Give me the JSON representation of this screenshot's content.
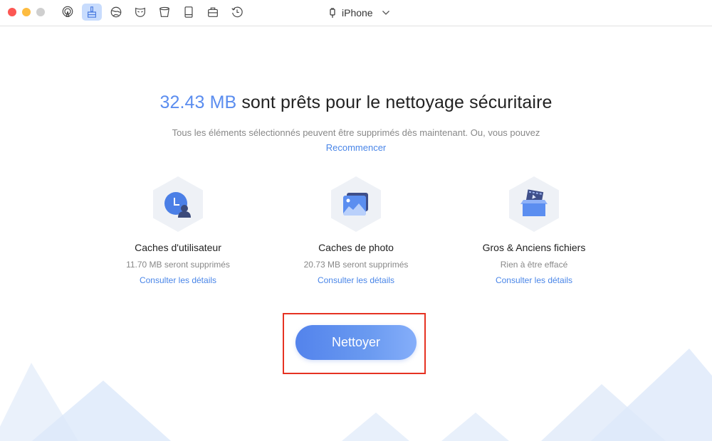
{
  "window": {
    "controls": [
      "close",
      "minimize",
      "maximize"
    ]
  },
  "toolbar": {
    "tools": [
      {
        "name": "airbackup-icon",
        "active": false
      },
      {
        "name": "cleaner-broom-icon",
        "active": true
      },
      {
        "name": "internet-globe-icon",
        "active": false
      },
      {
        "name": "privacy-mask-icon",
        "active": false
      },
      {
        "name": "trash-bin-icon",
        "active": false
      },
      {
        "name": "device-tablet-icon",
        "active": false
      },
      {
        "name": "toolkit-briefcase-icon",
        "active": false
      },
      {
        "name": "history-clock-icon",
        "active": false
      }
    ],
    "device_name": "iPhone"
  },
  "main": {
    "headline_size": "32.43 MB",
    "headline_rest": " sont prêts pour le nettoyage sécuritaire",
    "subtitle": "Tous les éléments sélectionnés peuvent être supprimés dès maintenant. Ou, vous pouvez",
    "restart_link": "Recommencer",
    "categories": [
      {
        "title": "Caches d'utilisateur",
        "status": "11.70 MB seront supprimés",
        "link": "Consulter les détails"
      },
      {
        "title": "Caches de photo",
        "status": "20.73 MB seront supprimés",
        "link": "Consulter les détails"
      },
      {
        "title": "Gros & Anciens fichiers",
        "status": "Rien à être effacé",
        "link": "Consulter les détails"
      }
    ],
    "clean_button": "Nettoyer"
  },
  "colors": {
    "accent": "#5b8def",
    "link": "#4a86e8",
    "highlight_border": "#e63222"
  }
}
